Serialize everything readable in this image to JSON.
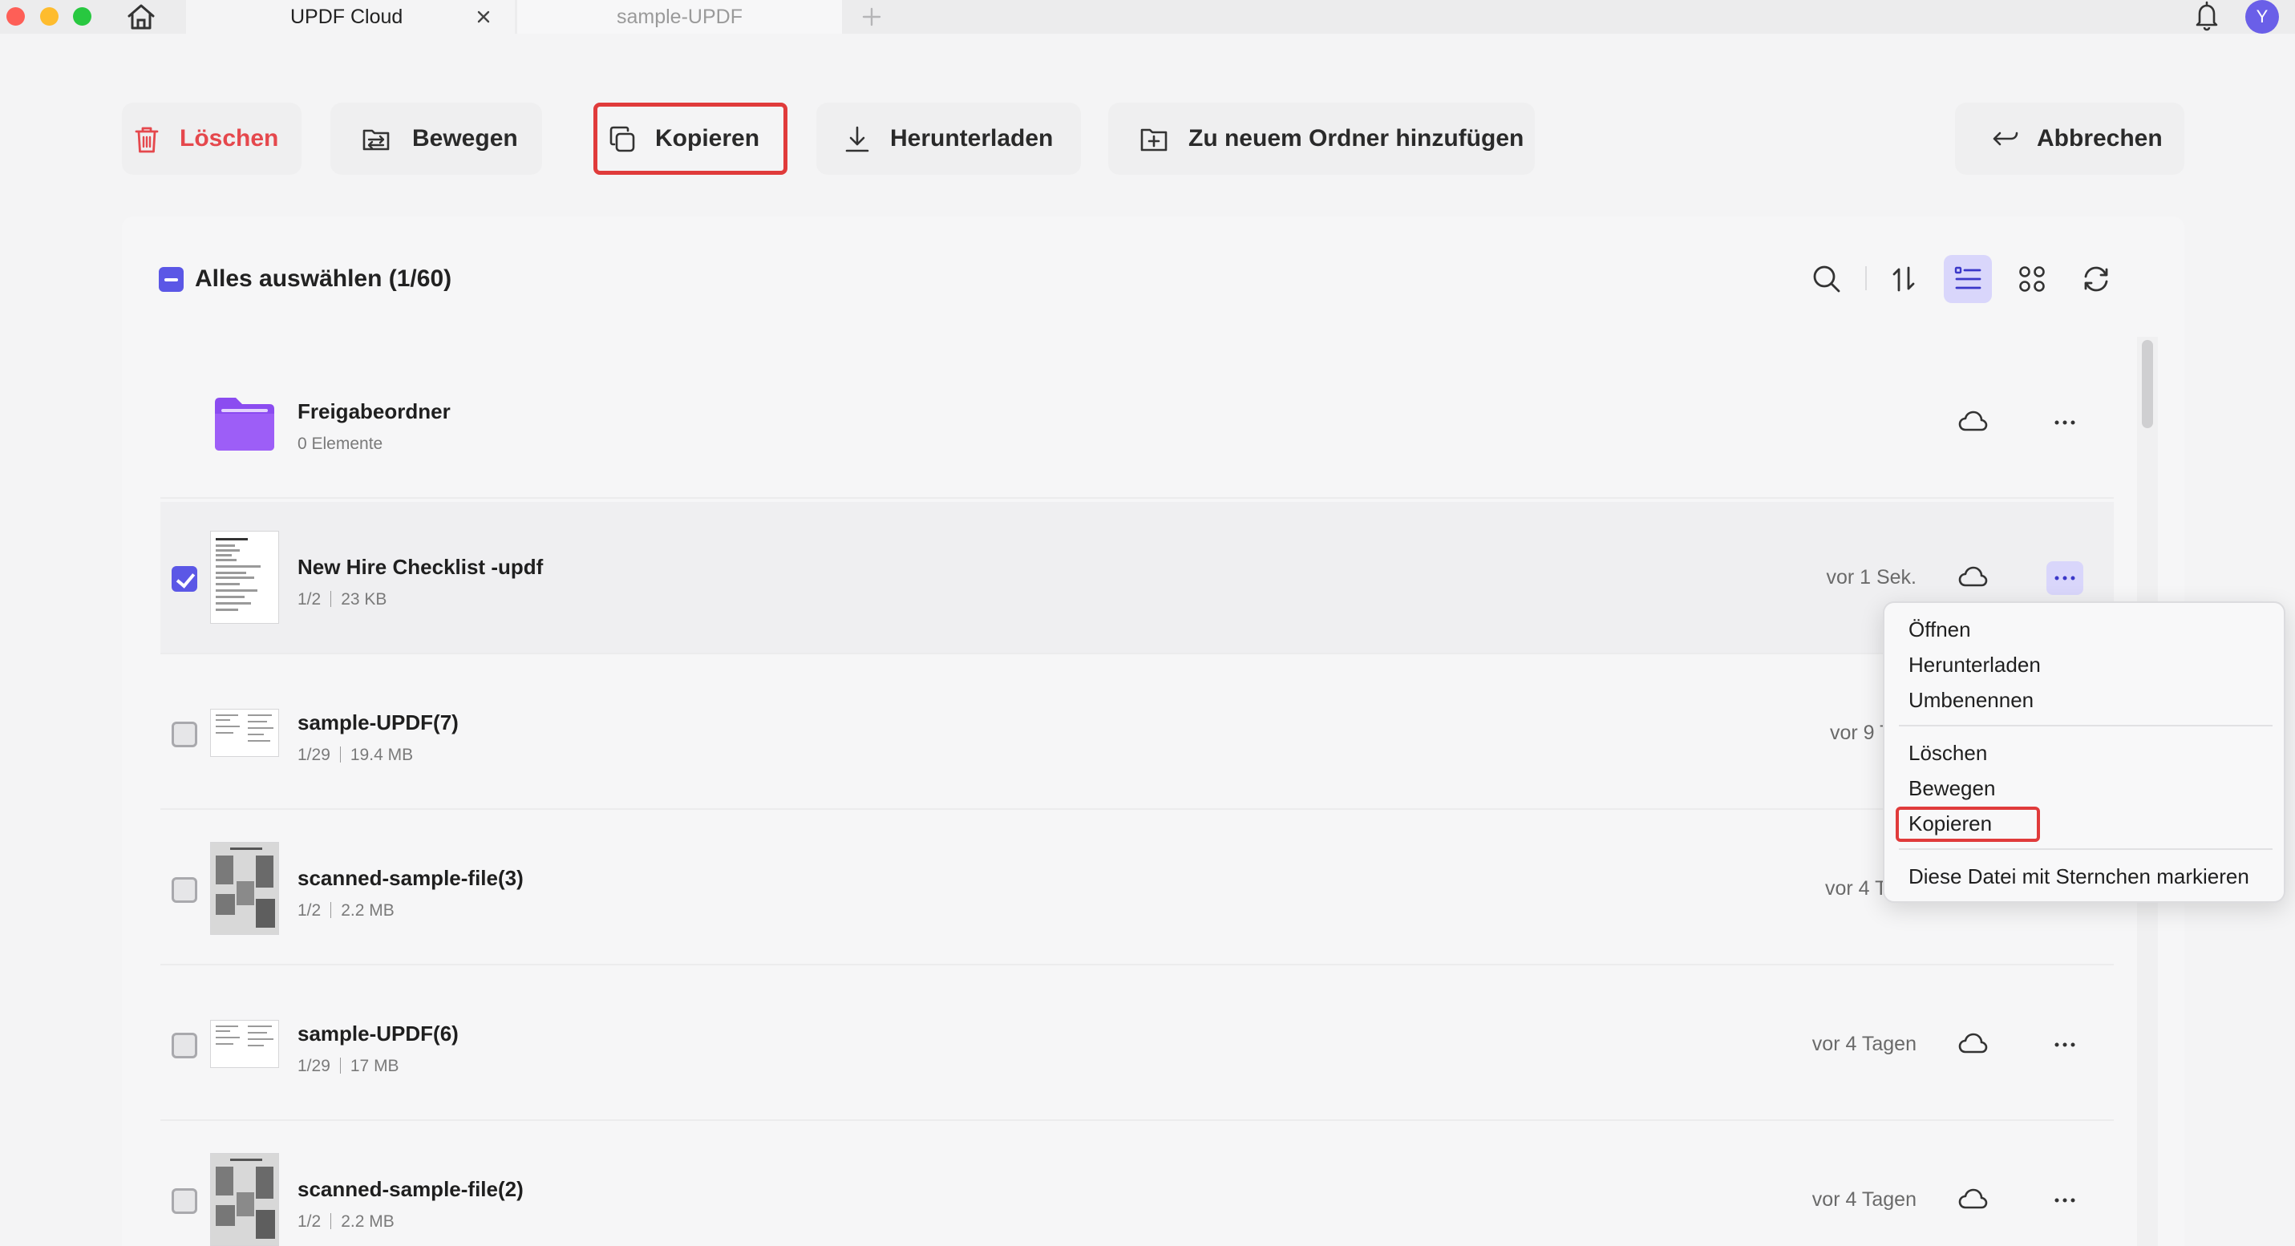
{
  "window": {
    "tabs": [
      {
        "label": "UPDF Cloud",
        "active": true
      },
      {
        "label": "sample-UPDF",
        "active": false
      }
    ],
    "avatar_initial": "Y",
    "traffic_colors": {
      "close": "#fe5f57",
      "minimize": "#febc2e",
      "zoom": "#28c840"
    }
  },
  "toolbar": {
    "delete_label": "Löschen",
    "move_label": "Bewegen",
    "copy_label": "Kopieren",
    "download_label": "Herunterladen",
    "add_folder_label": "Zu neuem Ordner hinzufügen",
    "cancel_label": "Abbrechen"
  },
  "list": {
    "select_all_label": "Alles auswählen (1/60)",
    "items": [
      {
        "name": "Freigabeordner",
        "meta": "0 Elemente",
        "type": "folder"
      },
      {
        "name": "New Hire Checklist -updf",
        "pages": "1/2",
        "size": "23 KB",
        "time": "vor 1 Sek.",
        "checked": true
      },
      {
        "name": "sample-UPDF(7)",
        "pages": "1/29",
        "size": "19.4 MB",
        "time": "vor 9 T",
        "checked": false
      },
      {
        "name": "scanned-sample-file(3)",
        "pages": "1/2",
        "size": "2.2 MB",
        "time": "vor 4 T",
        "checked": false
      },
      {
        "name": "sample-UPDF(6)",
        "pages": "1/29",
        "size": "17 MB",
        "time": "vor 4 Tagen",
        "checked": false
      },
      {
        "name": "scanned-sample-file(2)",
        "pages": "1/2",
        "size": "2.2 MB",
        "time": "vor 4 Tagen",
        "checked": false
      }
    ]
  },
  "context_menu": {
    "items": [
      "Öffnen",
      "Herunterladen",
      "Umbenennen",
      "Löschen",
      "Bewegen",
      "Kopieren",
      "Diese Datei mit Sternchen markieren"
    ]
  },
  "colors": {
    "accent": "#5b57e6",
    "accent_light": "#d9d6fb",
    "danger": "#e5484d",
    "highlight_box": "#e03b3b",
    "folder": "#8b4cf0"
  }
}
